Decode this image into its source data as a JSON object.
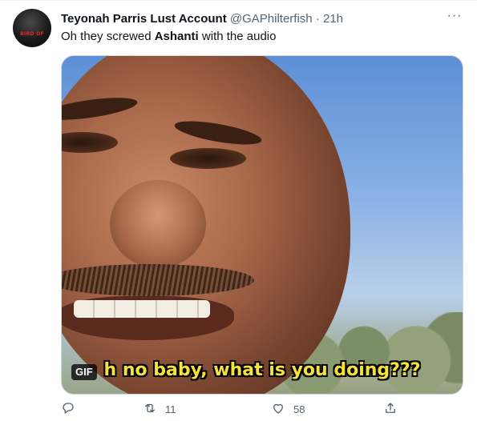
{
  "tweet": {
    "author_name": "Teyonah Parris Lust Account",
    "handle": "@GAPhilterfish",
    "separator": "·",
    "time": "21h",
    "text_before": "Oh they screwed ",
    "text_bold": "Ashanti",
    "text_after": " with the audio",
    "more_label": "···"
  },
  "avatar": {
    "badge_part1": "BIRD",
    "badge_part2": "OF"
  },
  "media": {
    "type_badge": "GIF",
    "caption": "h no baby, what is you doing???"
  },
  "actions": {
    "reply_count": "",
    "retweet_count": "11",
    "like_count": "58",
    "share_count": ""
  },
  "icons": {
    "reply": "reply-icon",
    "retweet": "retweet-icon",
    "like": "heart-icon",
    "share": "share-icon",
    "more": "more-options-icon"
  },
  "colors": {
    "text_primary": "#0f1419",
    "text_secondary": "#536471",
    "caption_yellow": "#f5e23a"
  }
}
